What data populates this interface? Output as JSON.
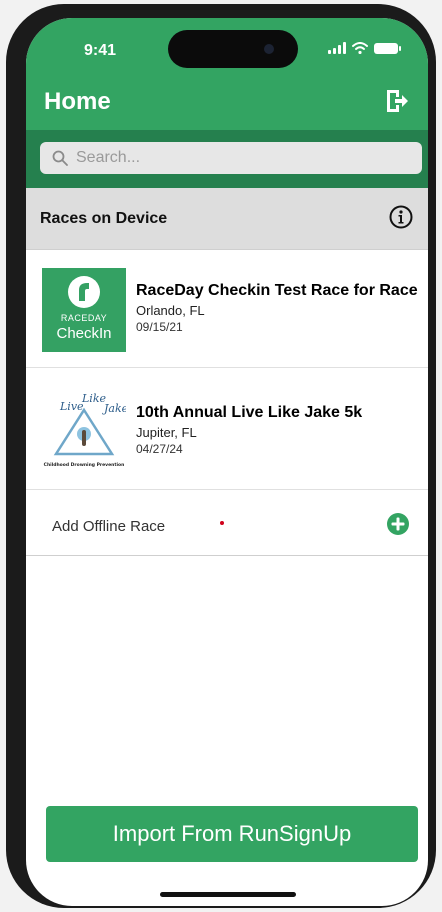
{
  "status_bar": {
    "time": "9:41"
  },
  "header": {
    "title": "Home"
  },
  "search": {
    "placeholder": "Search..."
  },
  "section": {
    "title": "Races on Device"
  },
  "logo_checkin": {
    "line1": "RACEDAY",
    "line2": "CheckIn"
  },
  "logo_jake": {
    "arc_text": "Live Like Jake",
    "footer_text": "Childhood Drowning Prevention"
  },
  "races": [
    {
      "name": "RaceDay Checkin Test Race for Race",
      "location": "Orlando, FL",
      "date": "09/15/21"
    },
    {
      "name": "10th Annual Live Like Jake 5k",
      "location": "Jupiter, FL",
      "date": "04/27/24"
    }
  ],
  "add_offline": {
    "label": "Add Offline Race"
  },
  "import_button": {
    "label": "Import From RunSignUp"
  },
  "colors": {
    "brand_green": "#33a462",
    "dark_green": "#25804e",
    "section_gray": "#dddddd"
  }
}
